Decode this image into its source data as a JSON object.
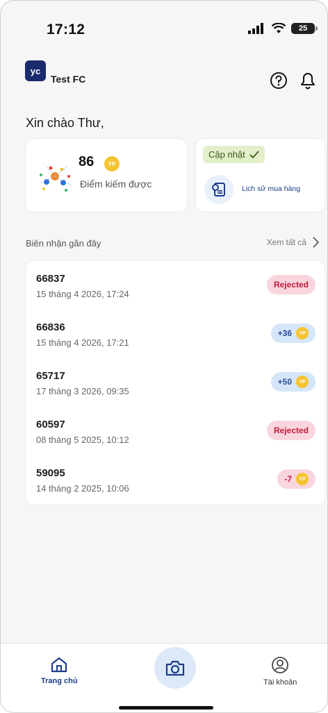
{
  "status_bar": {
    "time": "17:12",
    "battery": "25"
  },
  "header": {
    "logo_text": "yc",
    "org_name": "Test FC"
  },
  "greeting": "Xin chào Thư,",
  "points": {
    "value": "86",
    "label": "Điểm kiếm được",
    "coin_text": "YP"
  },
  "update": {
    "label": "Cập nhật",
    "history_label": "Lịch sử mua hàng"
  },
  "receipts_section": {
    "title": "Biên nhận gần đây",
    "see_all": "Xem tất cả"
  },
  "receipts": [
    {
      "id": "66837",
      "date": "15 tháng 4 2026, 17:24",
      "badge": "Rejected",
      "type": "rejected"
    },
    {
      "id": "66836",
      "date": "15 tháng 4 2026, 17:21",
      "badge": "+36",
      "type": "plus"
    },
    {
      "id": "65717",
      "date": "17 tháng 3 2026, 09:35",
      "badge": "+50",
      "type": "plus"
    },
    {
      "id": "60597",
      "date": "08 tháng 5 2025, 10:12",
      "badge": "Rejected",
      "type": "rejected"
    },
    {
      "id": "59095",
      "date": "14 tháng 2 2025, 10:06",
      "badge": "-7",
      "type": "minus"
    }
  ],
  "nav": {
    "home": "Trang chủ",
    "account": "Tài khoản"
  },
  "colors": {
    "brand": "#1c2a6e",
    "coin": "#f5c430",
    "rejected_bg": "#f9d6de",
    "plus_bg": "#d5e6f9"
  }
}
